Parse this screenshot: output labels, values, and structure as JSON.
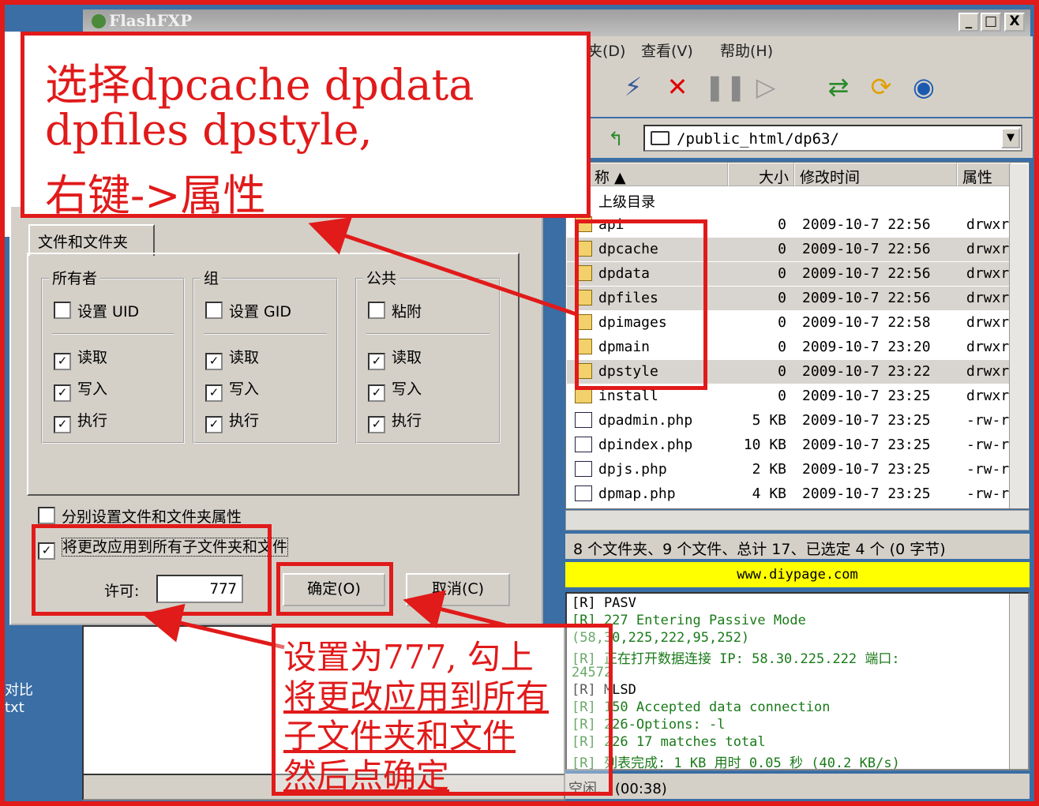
{
  "window": {
    "title": "FlashFXP",
    "min": "_",
    "max": "□",
    "close": "X"
  },
  "menu": {
    "item1": "夹(D)",
    "item2": "查看(V)",
    "item3": "帮助(H)"
  },
  "address": {
    "path": "/public_html/dp63/"
  },
  "file_list": {
    "headers": {
      "name": "称",
      "size": "大小",
      "modified": "修改时间",
      "attr": "属性"
    },
    "parent_dir": "上级目录",
    "rows": [
      {
        "name": "api",
        "size": "0",
        "date": "2009-10-7 22:56",
        "attr": "drwxr"
      },
      {
        "name": "dpcache",
        "size": "0",
        "date": "2009-10-7 22:56",
        "attr": "drwxr"
      },
      {
        "name": "dpdata",
        "size": "0",
        "date": "2009-10-7 22:56",
        "attr": "drwxr"
      },
      {
        "name": "dpfiles",
        "size": "0",
        "date": "2009-10-7 22:56",
        "attr": "drwxr"
      },
      {
        "name": "dpimages",
        "size": "0",
        "date": "2009-10-7 22:58",
        "attr": "drwxr"
      },
      {
        "name": "dpmain",
        "size": "0",
        "date": "2009-10-7 23:20",
        "attr": "drwxr"
      },
      {
        "name": "dpstyle",
        "size": "0",
        "date": "2009-10-7 23:22",
        "attr": "drwxr"
      },
      {
        "name": "install",
        "size": "0",
        "date": "2009-10-7 23:25",
        "attr": "drwxr"
      },
      {
        "name": "dpadmin.php",
        "size": "5 KB",
        "date": "2009-10-7 23:25",
        "attr": "-rw-r"
      },
      {
        "name": "dpindex.php",
        "size": "10 KB",
        "date": "2009-10-7 23:25",
        "attr": "-rw-r"
      },
      {
        "name": "dpjs.php",
        "size": "2 KB",
        "date": "2009-10-7 23:25",
        "attr": "-rw-r"
      },
      {
        "name": "dpmap.php",
        "size": "4 KB",
        "date": "2009-10-7 23:25",
        "attr": "-rw-r"
      }
    ]
  },
  "status": "8 个文件夹、9 个文件、总计 17、已选定 4 个 (0 字节)",
  "banner": "www.diypage.com",
  "log": {
    "l1": "[R] PASV",
    "l2": "[R] 227 Entering Passive Mode",
    "l3": "(58,30,225,222,95,252)",
    "l4": "[R] 正在打开数据连接 IP: 58.30.225.222 端口:",
    "l5": "24572",
    "l6": "[R] MLSD",
    "l7": "[R] 150 Accepted data connection",
    "l8": "[R] 226-Options: -l",
    "l9": "[R] 226 17 matches total",
    "l10": "[R] 列表完成: 1 KB 用时 0.05 秒 (40.2 KB/s)"
  },
  "bottom_status": {
    "state": "空闲.",
    "time": "(00:38)"
  },
  "dialog": {
    "tab": "文件和文件夹",
    "owner": {
      "label": "所有者",
      "special": "设置 UID",
      "read": "读取",
      "write": "写入",
      "exec": "执行"
    },
    "group": {
      "label": "组",
      "special": "设置 GID",
      "read": "读取",
      "write": "写入",
      "exec": "执行"
    },
    "public": {
      "label": "公共",
      "special": "粘附",
      "read": "读取",
      "write": "写入",
      "exec": "执行"
    },
    "separate_label": "分别设置文件和文件夹属性",
    "recursive_label": "将更改应用到所有子文件夹和文件",
    "permission_label": "许可:",
    "permission_value": "777",
    "ok_label": "确定(O)",
    "cancel_label": "取消(C)"
  },
  "left_panel": {
    "t1": "对比",
    "t2": "txt"
  },
  "callouts": {
    "top_l1": "选择dpcache dpdata",
    "top_l2": "dpfiles dpstyle,",
    "top_l3": "右键->属性",
    "bottom_l1": "设置为777, 勾上",
    "bottom_l2": "将更改应用到所有",
    "bottom_l3": "子文件夹和文件",
    "bottom_l4": "然后点确定"
  },
  "colors": {
    "annotation": "#e11a1a",
    "banner": "#ffff00",
    "log_green": "#1a7a1a"
  }
}
